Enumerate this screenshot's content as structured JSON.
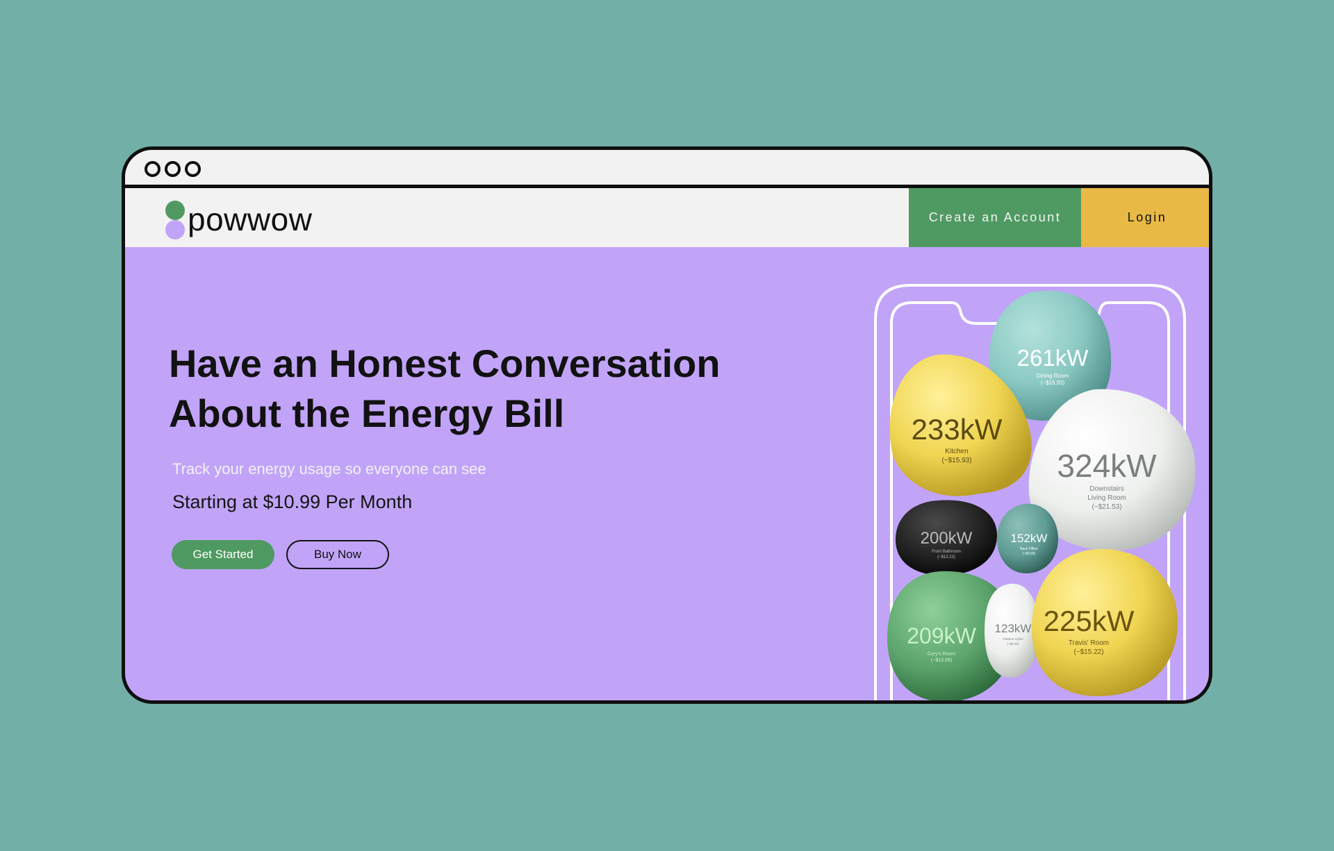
{
  "window": {
    "controls": [
      "window-dot",
      "window-dot",
      "window-dot"
    ]
  },
  "brand": {
    "name": "powwow",
    "colors": {
      "green": "#4f9a62",
      "lavender": "#c1a4f8",
      "yellow": "#e8b945",
      "teal_bg": "#72afa7"
    }
  },
  "nav": {
    "create_account_label": "Create an Account",
    "login_label": "Login"
  },
  "hero": {
    "title_line1": "Have an Honest Conversation",
    "title_line2": "About the Energy Bill",
    "subtitle": "Track your energy usage so everyone can see",
    "price": "Starting at $10.99 Per Month",
    "get_started_label": "Get Started",
    "buy_now_label": "Buy Now"
  },
  "rooms": [
    {
      "kw": "261kW",
      "room": "Dining Room",
      "cost": "(~$16.93)",
      "color": "#8cc9c3"
    },
    {
      "kw": "233kW",
      "room": "Kitchen",
      "cost": "(~$15.93)",
      "color": "#f0d552"
    },
    {
      "kw": "324kW",
      "room": "Downstairs Living Room",
      "room_line1": "Downstairs",
      "room_line2": "Living Room",
      "cost": "(~$21.53)",
      "color": "#eef0ee"
    },
    {
      "kw": "200kW",
      "room": "Front Bathroom",
      "cost": "(~$13.23)",
      "color": "#222222"
    },
    {
      "kw": "152kW",
      "room": "Back Office",
      "cost": "(~$9.99)",
      "color": "#5f9c94"
    },
    {
      "kw": "209kW",
      "room": "Cory's Room",
      "cost": "(~$13.69)",
      "color": "#5aa26a"
    },
    {
      "kw": "123kW",
      "room": "Outdoor Lights",
      "cost": "(~$8.45)",
      "color": "#e9ebe9"
    },
    {
      "kw": "225kW",
      "room": "Travis' Room",
      "cost": "(~$15.22)",
      "color": "#f0d552"
    }
  ]
}
